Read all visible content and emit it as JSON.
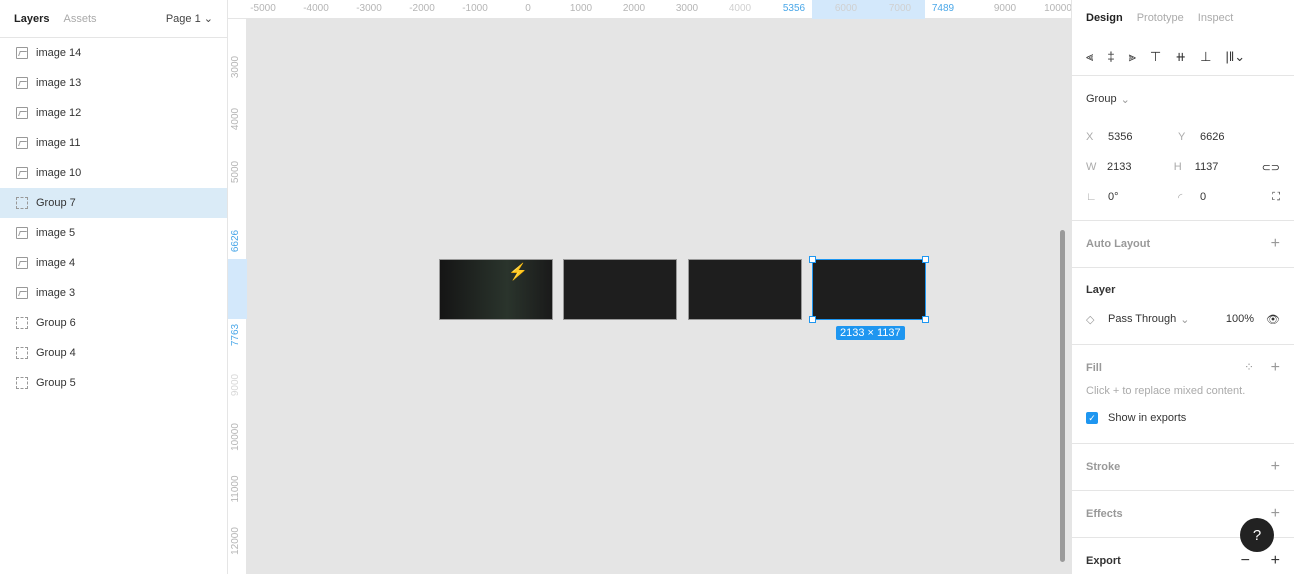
{
  "left_panel": {
    "tabs": [
      "Layers",
      "Assets"
    ],
    "page": "Page 1",
    "layers": [
      {
        "name": "image 14",
        "type": "image"
      },
      {
        "name": "image 13",
        "type": "image"
      },
      {
        "name": "image 12",
        "type": "image"
      },
      {
        "name": "image 11",
        "type": "image"
      },
      {
        "name": "image 10",
        "type": "image"
      },
      {
        "name": "Group 7",
        "type": "group",
        "selected": true
      },
      {
        "name": "image 5",
        "type": "image"
      },
      {
        "name": "image 4",
        "type": "image"
      },
      {
        "name": "image 3",
        "type": "image"
      },
      {
        "name": "Group 6",
        "type": "group"
      },
      {
        "name": "Group 4",
        "type": "group"
      },
      {
        "name": "Group 5",
        "type": "group"
      }
    ]
  },
  "ruler_top": [
    "-5000",
    "-4000",
    "-3000",
    "-2000",
    "-1000",
    "0",
    "1000",
    "2000",
    "3000",
    "4000",
    "5356",
    "6000",
    "7000",
    "7489",
    "9000",
    "10000"
  ],
  "ruler_left": [
    "3000",
    "4000",
    "5000",
    "6626",
    "7763",
    "9000",
    "10000",
    "11000",
    "12000"
  ],
  "canvas": {
    "selection_size": "2133 × 1137",
    "accent": "#1e96f0"
  },
  "right_panel": {
    "tabs": [
      "Design",
      "Prototype",
      "Inspect"
    ],
    "type": "Group",
    "x": "5356",
    "y": "6626",
    "w": "2133",
    "h": "1137",
    "rotation": "0°",
    "radius": "0",
    "labels": {
      "x": "X",
      "y": "Y",
      "w": "W",
      "h": "H"
    },
    "auto_layout": "Auto Layout",
    "layer": "Layer",
    "blend": "Pass Through",
    "opacity": "100%",
    "fill": "Fill",
    "fill_hint": "Click + to replace mixed content.",
    "show_exports": "Show in exports",
    "stroke": "Stroke",
    "effects": "Effects",
    "export": "Export"
  },
  "help": "?"
}
